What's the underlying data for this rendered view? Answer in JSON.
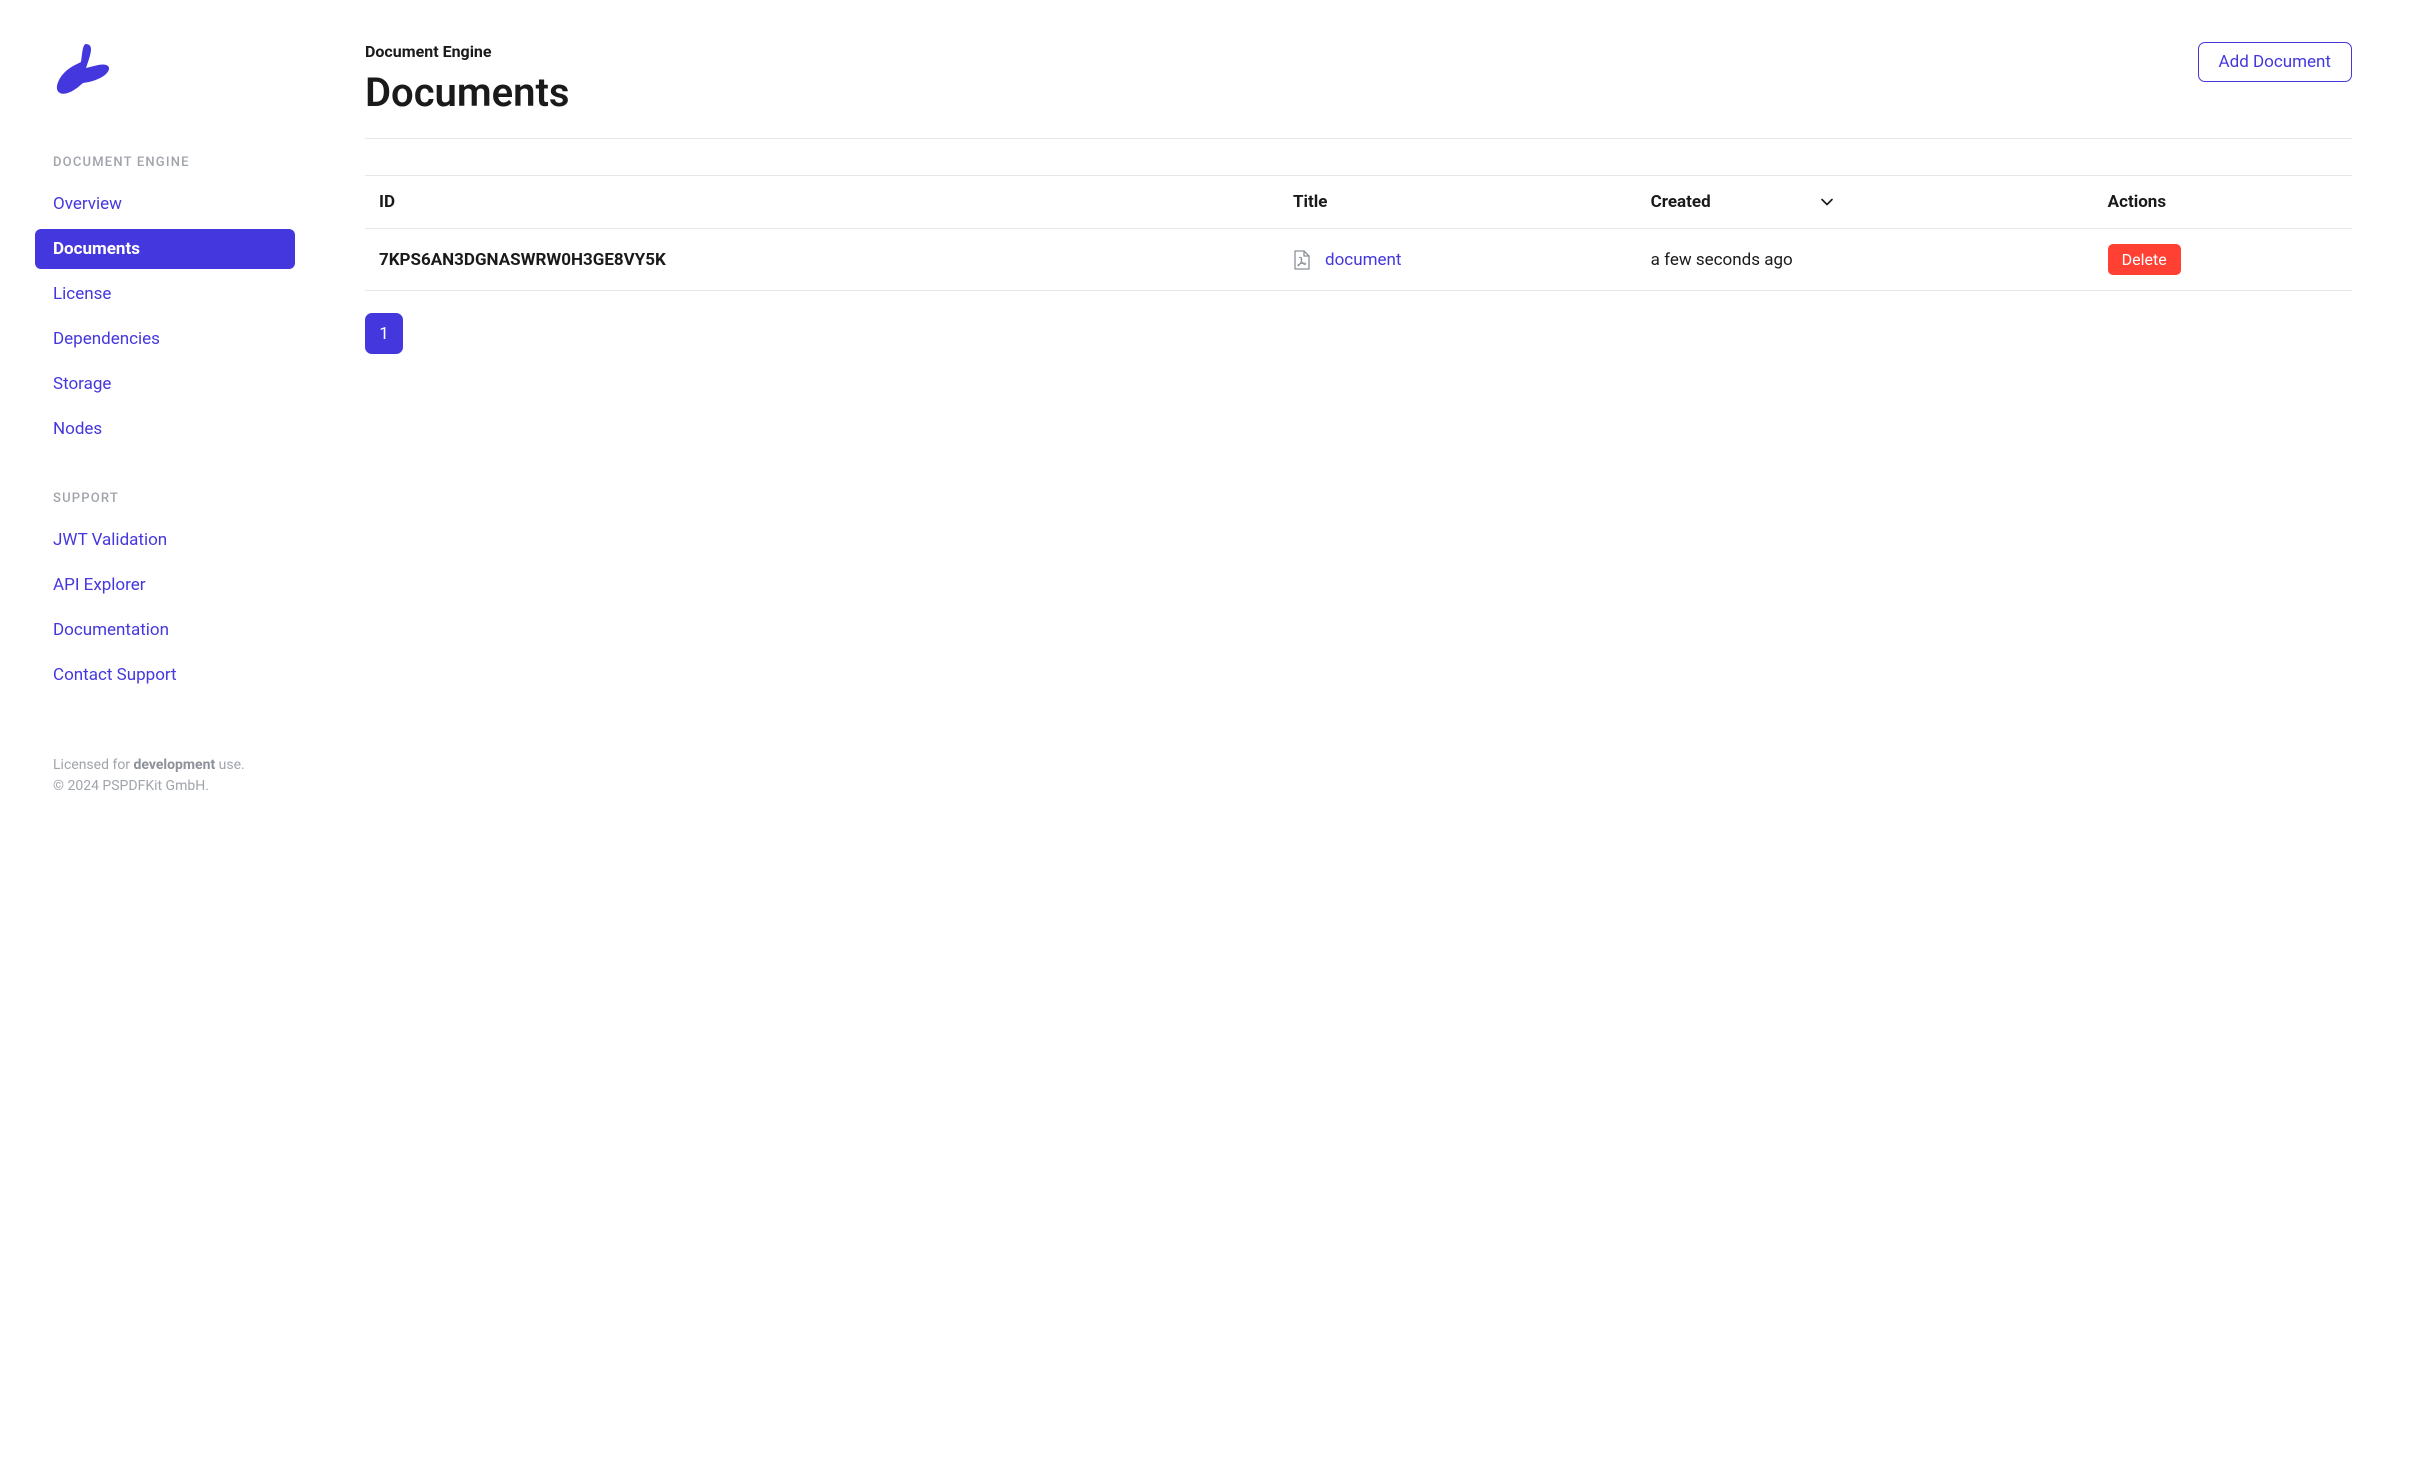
{
  "sidebar": {
    "sections": [
      {
        "header": "DOCUMENT ENGINE",
        "items": [
          {
            "label": "Overview",
            "active": false
          },
          {
            "label": "Documents",
            "active": true
          },
          {
            "label": "License",
            "active": false
          },
          {
            "label": "Dependencies",
            "active": false
          },
          {
            "label": "Storage",
            "active": false
          },
          {
            "label": "Nodes",
            "active": false
          }
        ]
      },
      {
        "header": "SUPPORT",
        "items": [
          {
            "label": "JWT Validation",
            "active": false
          },
          {
            "label": "API Explorer",
            "active": false
          },
          {
            "label": "Documentation",
            "active": false
          },
          {
            "label": "Contact Support",
            "active": false
          }
        ]
      }
    ],
    "footer": {
      "licensed_prefix": "Licensed for ",
      "licensed_bold": "development",
      "licensed_suffix": " use.",
      "copyright": "© 2024 PSPDFKit GmbH."
    }
  },
  "header": {
    "subtitle": "Document Engine",
    "title": "Documents",
    "add_button": "Add Document"
  },
  "table": {
    "columns": {
      "id": "ID",
      "title": "Title",
      "created": "Created",
      "actions": "Actions"
    },
    "rows": [
      {
        "id": "7KPS6AN3DGNASWRW0H3GE8VY5K",
        "title": "document",
        "created": "a few seconds ago",
        "delete_label": "Delete"
      }
    ]
  },
  "pagination": {
    "current": "1"
  }
}
